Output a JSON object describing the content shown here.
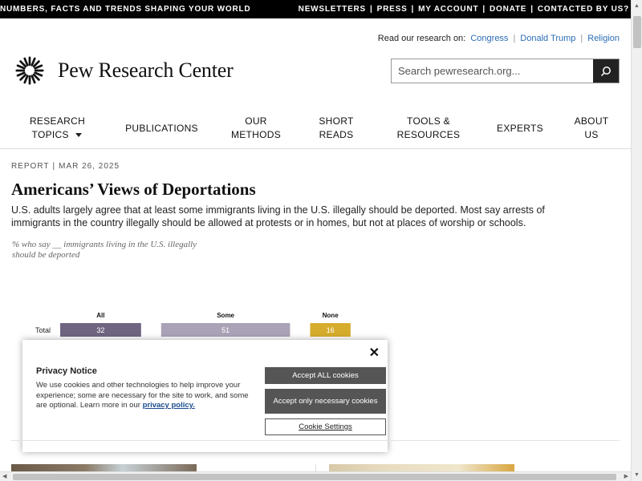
{
  "topbar": {
    "tagline": "NUMBERS, FACTS AND TRENDS SHAPING YOUR WORLD",
    "links": [
      "NEWSLETTERS",
      "PRESS",
      "MY ACCOUNT",
      "DONATE",
      "CONTACTED BY US?"
    ]
  },
  "readon": {
    "label": "Read our research on:",
    "topics": [
      "Congress",
      "Donald Trump",
      "Religion"
    ]
  },
  "logo": {
    "name": "Pew Research Center"
  },
  "search": {
    "placeholder": "Search pewresearch.org..."
  },
  "nav": {
    "items": [
      {
        "line1": "RESEARCH",
        "line2": "TOPICS"
      },
      {
        "line1": "PUBLICATIONS",
        "line2": ""
      },
      {
        "line1": "OUR",
        "line2": "METHODS"
      },
      {
        "line1": "SHORT",
        "line2": "READS"
      },
      {
        "line1": "TOOLS &",
        "line2": "RESOURCES"
      },
      {
        "line1": "EXPERTS",
        "line2": ""
      },
      {
        "line1": "ABOUT",
        "line2": "US"
      }
    ]
  },
  "article": {
    "kicker_type": "REPORT",
    "kicker_date": "MAR 26, 2025",
    "title": "Americans’ Views of Deportations",
    "subtitle": "U.S. adults largely agree that at least some immigrants living in the U.S. illegally should be deported. Most say arrests of immigrants in the country illegally should be allowed at protests or in homes, but not at places of worship or schools.",
    "chart_caption": "% who say __ immigrants living in the U.S. illegally should be deported"
  },
  "chart_data": {
    "type": "bar",
    "categories": [
      "Total"
    ],
    "series": [
      {
        "name": "All",
        "values": [
          32
        ],
        "color": "#6f6580"
      },
      {
        "name": "Some",
        "values": [
          51
        ],
        "color": "#aaa2b6"
      },
      {
        "name": "None",
        "values": [
          16
        ],
        "color": "#d6ac2c"
      }
    ],
    "stacked": true
  },
  "cookie": {
    "heading": "Privacy Notice",
    "body": "We use cookies and other technologies to help improve your experience; some are necessary for the site to work, and some are optional. Learn more in our",
    "link": "privacy policy.",
    "accept_all": "Accept ALL cookies",
    "accept_necessary": "Accept only necessary cookies",
    "settings": "Cookie Settings"
  }
}
